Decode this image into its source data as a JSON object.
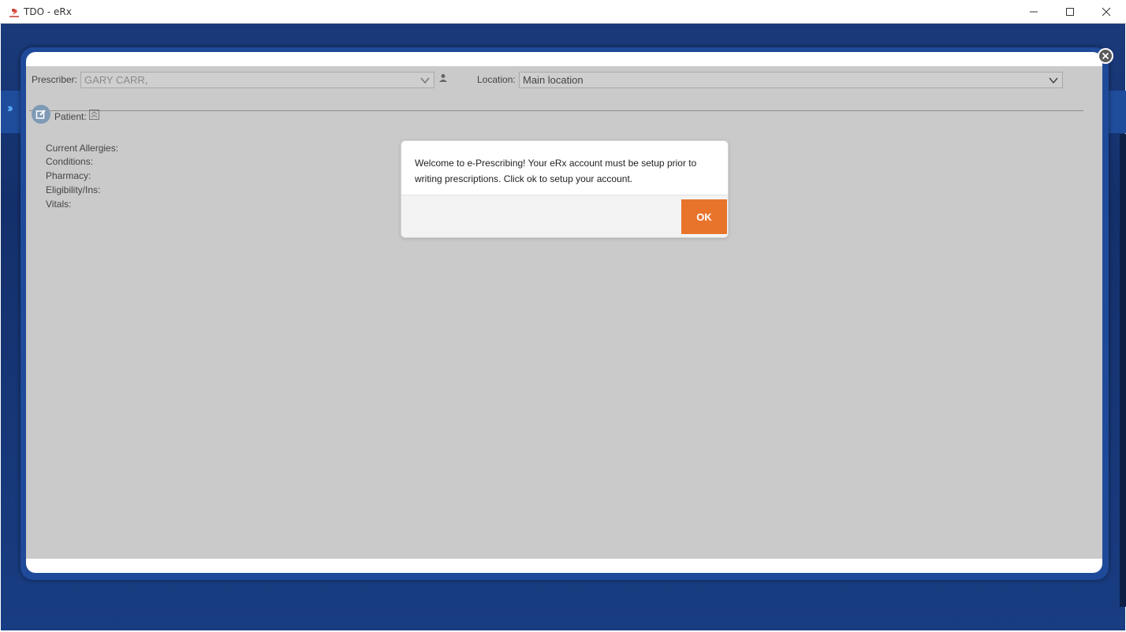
{
  "window": {
    "title": "TDO - eRx"
  },
  "prescriber": {
    "label": "Prescriber:",
    "value": "GARY CARR,"
  },
  "location": {
    "label": "Location:",
    "value": "Main location"
  },
  "patient": {
    "label": "Patient:"
  },
  "info": {
    "allergies_label": "Current Allergies:",
    "conditions_label": "Conditions:",
    "pharmacy_label": "Pharmacy:",
    "eligibility_label": "Eligibility/Ins:",
    "vitals_label": "Vitals:"
  },
  "dialog": {
    "message": "Welcome to e-Prescribing! Your eRx account must be setup prior to writing prescriptions. Click ok to setup your account.",
    "ok_label": "OK"
  },
  "colors": {
    "accent_orange": "#e8742c",
    "frame_blue": "#1e4a99",
    "overlay_gray": "#cacaca"
  }
}
